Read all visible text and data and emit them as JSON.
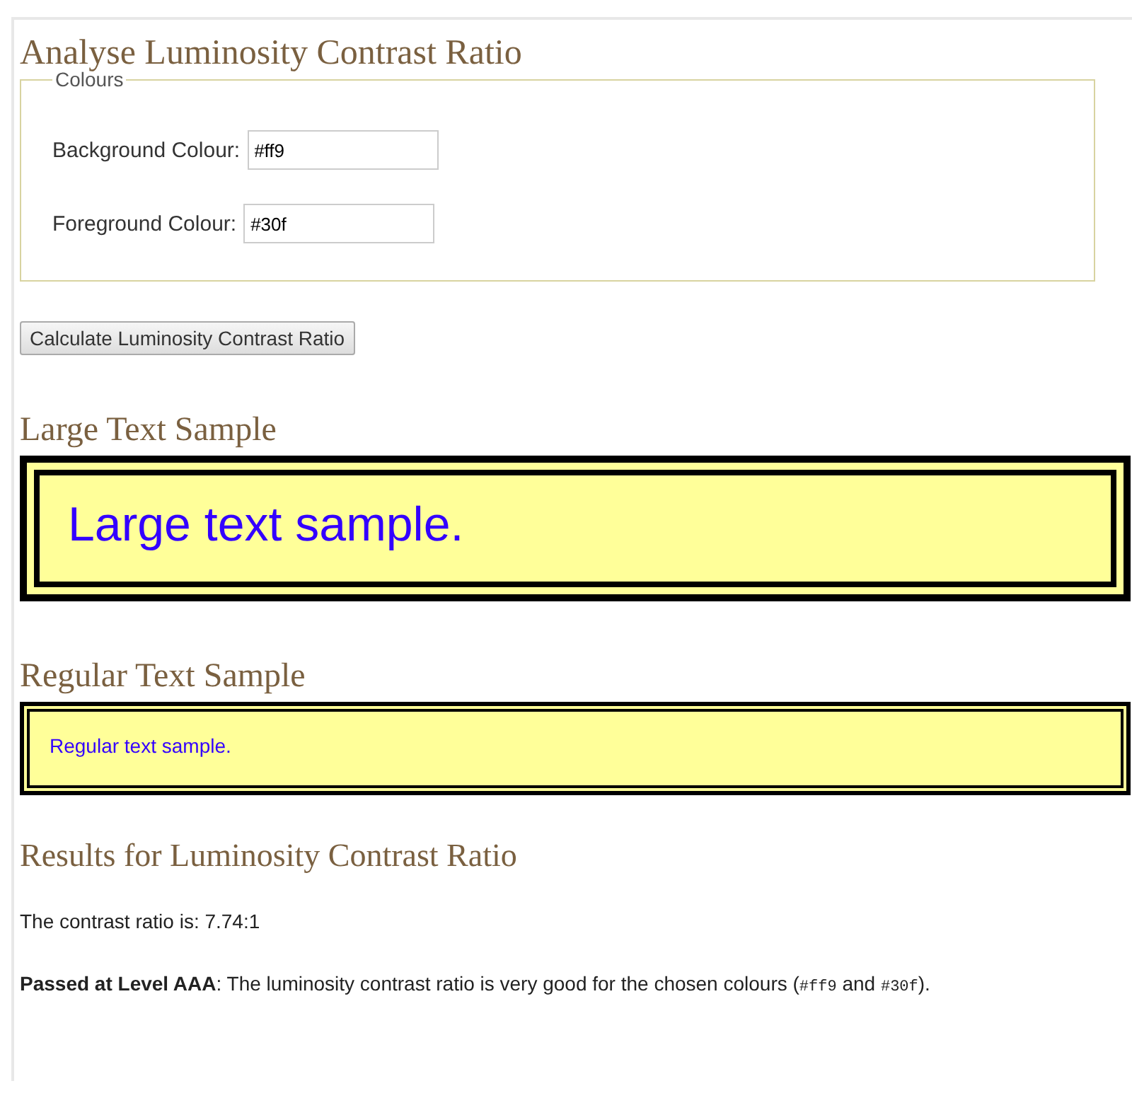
{
  "title": "Analyse Luminosity Contrast Ratio",
  "colours": {
    "legend": "Colours",
    "fields": [
      {
        "label": "Background Colour:",
        "value": "#ff9"
      },
      {
        "label": "Foreground Colour:",
        "value": "#30f"
      }
    ]
  },
  "calculate_button": "Calculate Luminosity Contrast Ratio",
  "large_sample": {
    "heading": "Large Text Sample",
    "text": "Large text sample."
  },
  "regular_sample": {
    "heading": "Regular Text Sample",
    "text": "Regular text sample."
  },
  "results": {
    "heading": "Results for Luminosity Contrast Ratio",
    "ratio_text": "The contrast ratio is: 7.74:1",
    "verdict": [
      {
        "kind": "bold",
        "text": "Passed at Level AAA"
      },
      {
        "kind": "plain",
        "text": ": The luminosity contrast ratio is very good for the chosen colours ("
      },
      {
        "kind": "code",
        "text": "#ff9"
      },
      {
        "kind": "plain",
        "text": " and "
      },
      {
        "kind": "code",
        "text": "#30f"
      },
      {
        "kind": "plain",
        "text": ")."
      }
    ]
  }
}
